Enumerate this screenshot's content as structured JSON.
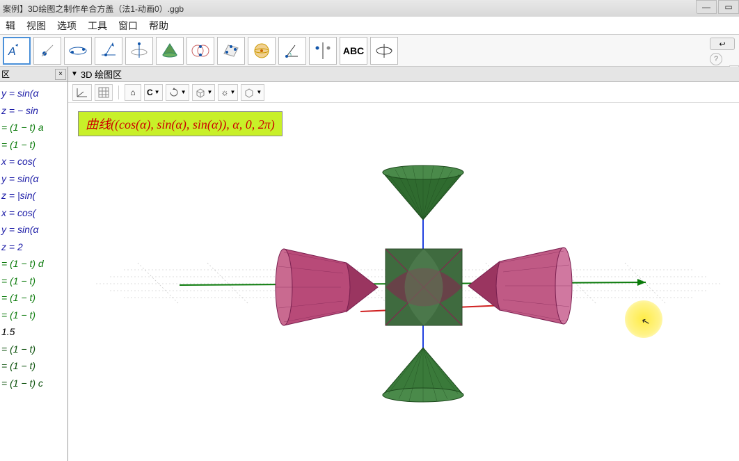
{
  "window": {
    "title": "案例】3D绘图之制作牟合方盖（法1-动画0）.ggb",
    "min": "—",
    "max": "▭",
    "close": "×"
  },
  "menu": {
    "edit": "辑",
    "view": "视图",
    "options": "选项",
    "tools": "工具",
    "window": "窗口",
    "help": "帮助"
  },
  "toolbar": {
    "abc": "ABC",
    "undo": "↩"
  },
  "sidebar": {
    "title": "区",
    "close": "×",
    "items": [
      {
        "cls": "blue",
        "t": "y = sin(α"
      },
      {
        "cls": "blue",
        "t": "z = − sin"
      },
      {
        "cls": "green",
        "t": "= (1 − t) a"
      },
      {
        "cls": "green",
        "t": "= (1 − t)"
      },
      {
        "cls": "blue",
        "t": "x = cos("
      },
      {
        "cls": "blue",
        "t": "y = sin(α"
      },
      {
        "cls": "blue",
        "t": "z = |sin("
      },
      {
        "cls": "blue",
        "t": "x = cos("
      },
      {
        "cls": "blue",
        "t": "y = sin(α"
      },
      {
        "cls": "blue",
        "t": "z = 2"
      },
      {
        "cls": "green",
        "t": "= (1 − t) d"
      },
      {
        "cls": "green",
        "t": "= (1 − t)"
      },
      {
        "cls": "green",
        "t": "= (1 − t)"
      },
      {
        "cls": "green",
        "t": "= (1 − t)"
      },
      {
        "cls": "black",
        "t": "1.5"
      },
      {
        "cls": "darkgreen",
        "t": "= (1 − t)"
      },
      {
        "cls": "darkgreen",
        "t": "= (1 − t)"
      },
      {
        "cls": "darkgreen",
        "t": "= (1 − t) c"
      }
    ]
  },
  "view3d": {
    "title": "3D 绘图区",
    "formula": "曲线((cos(α), sin(α), sin(α)), α, 0, 2π)"
  },
  "icons": {
    "home": "⌂",
    "rotate": "C",
    "sun": "☼",
    "help": "?"
  }
}
